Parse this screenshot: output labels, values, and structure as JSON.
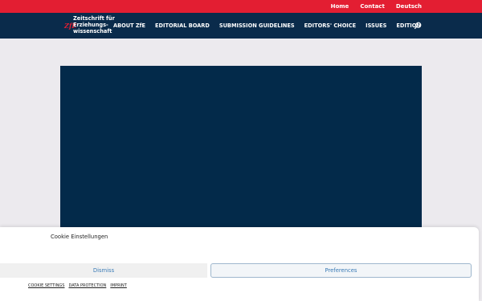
{
  "topbar": {
    "links": [
      "Home",
      "Contact",
      "Deutsch"
    ]
  },
  "logo": {
    "mark": "ZfE",
    "lines": [
      "Zeitschrift für",
      "Erziehungs-",
      "wissenschaft"
    ]
  },
  "nav": {
    "items": [
      "ABOUT ZfE",
      "EDITORIAL BOARD",
      "SUBMISSION GUIDELINES",
      "EDITORS' CHOICE",
      "ISSUES",
      "EDITION"
    ],
    "search_icon": "search-icon"
  },
  "cookie": {
    "title": "Cookie Einstellungen",
    "dismiss_label": "Dismiss",
    "preferences_label": "Preferences",
    "links": [
      "COOKIE SETTINGS",
      "DATA PROTECTION",
      "IMPRINT"
    ]
  },
  "colors": {
    "topbar": "#e31e32",
    "nav": "#0a2b4b",
    "hero": "#032a4a",
    "accent": "#3a7bb6"
  }
}
